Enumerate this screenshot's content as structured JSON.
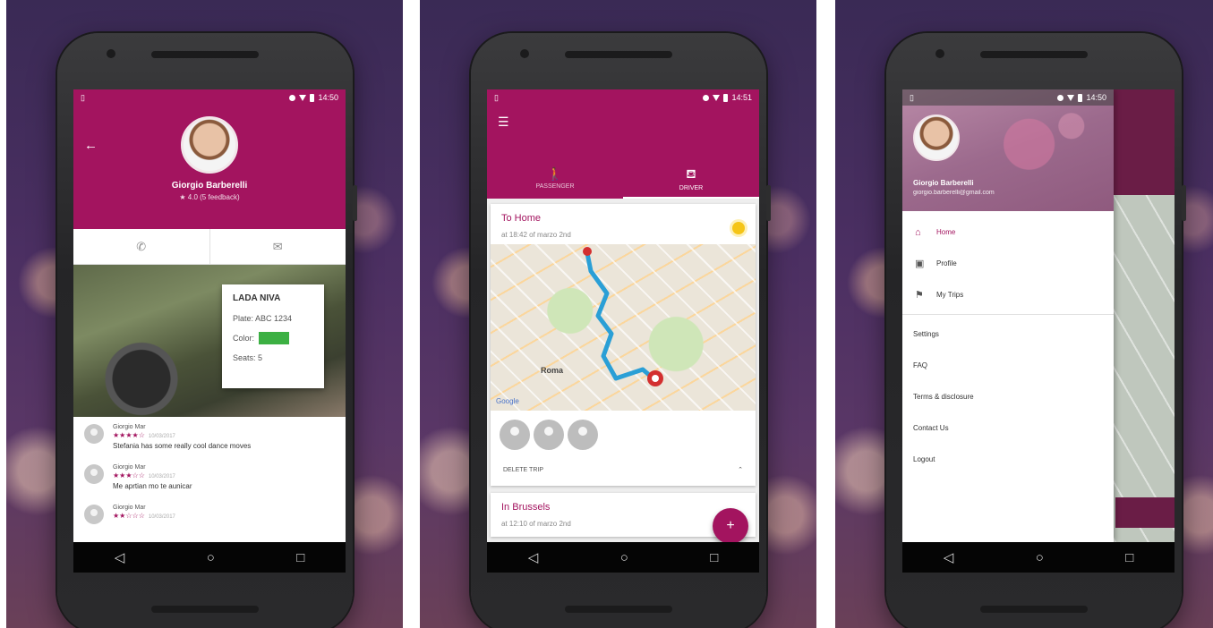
{
  "status": {
    "time1": "14:50",
    "time2": "14:51",
    "time3": "14:50"
  },
  "nav": {
    "back": "◁",
    "home": "○",
    "recent": "□"
  },
  "profile": {
    "name": "Giorgio Barberelli",
    "feedback": "4.0 (5 feedback)",
    "phone_icon": "phone-icon",
    "chat_icon": "chat-icon",
    "car": {
      "title": "LADA NIVA",
      "plate": "Plate: ABC 1234",
      "color_label": "Color:",
      "color_value": "#3cb043",
      "seats": "Seats: 5"
    },
    "reviews": [
      {
        "name": "Giorgio Mar",
        "stars": "★★★★☆",
        "date": "10/03/2017",
        "text": "Stefania has some really cool dance moves"
      },
      {
        "name": "Giorgio Mar",
        "stars": "★★★☆☆",
        "date": "10/03/2017",
        "text": "Me aprtian mo te aunicar"
      },
      {
        "name": "Giorgio Mar",
        "stars": "★★☆☆☆",
        "date": "10/03/2017",
        "text": ""
      }
    ]
  },
  "trips": {
    "tabs": [
      {
        "label": "PASSENGER",
        "icon": "walk-icon"
      },
      {
        "label": "DRIVER",
        "icon": "driver-icon"
      }
    ],
    "trip1": {
      "title": "To Home",
      "subtitle": "at 18:42 of marzo 2nd",
      "delete": "DELETE TRIP",
      "city": "Roma",
      "google": "Google"
    },
    "trip2": {
      "title": "In Brussels",
      "subtitle": "at 12:10 of marzo 2nd"
    },
    "fab": "+"
  },
  "drawer": {
    "name": "Giorgio Barberelli",
    "email": "giorgio.barberelli@gmail.com",
    "primary": [
      {
        "label": "Home",
        "icon": "home-icon",
        "glyph": "⌂"
      },
      {
        "label": "Profile",
        "icon": "profile-icon",
        "glyph": "▣"
      },
      {
        "label": "My Trips",
        "icon": "flag-icon",
        "glyph": "⚑"
      }
    ],
    "secondary": [
      "Settings",
      "FAQ",
      "Terms & disclosure",
      "Contact Us",
      "Logout"
    ]
  },
  "colors": {
    "accent": "#a3145f",
    "status_yellow": "#f5c518"
  }
}
